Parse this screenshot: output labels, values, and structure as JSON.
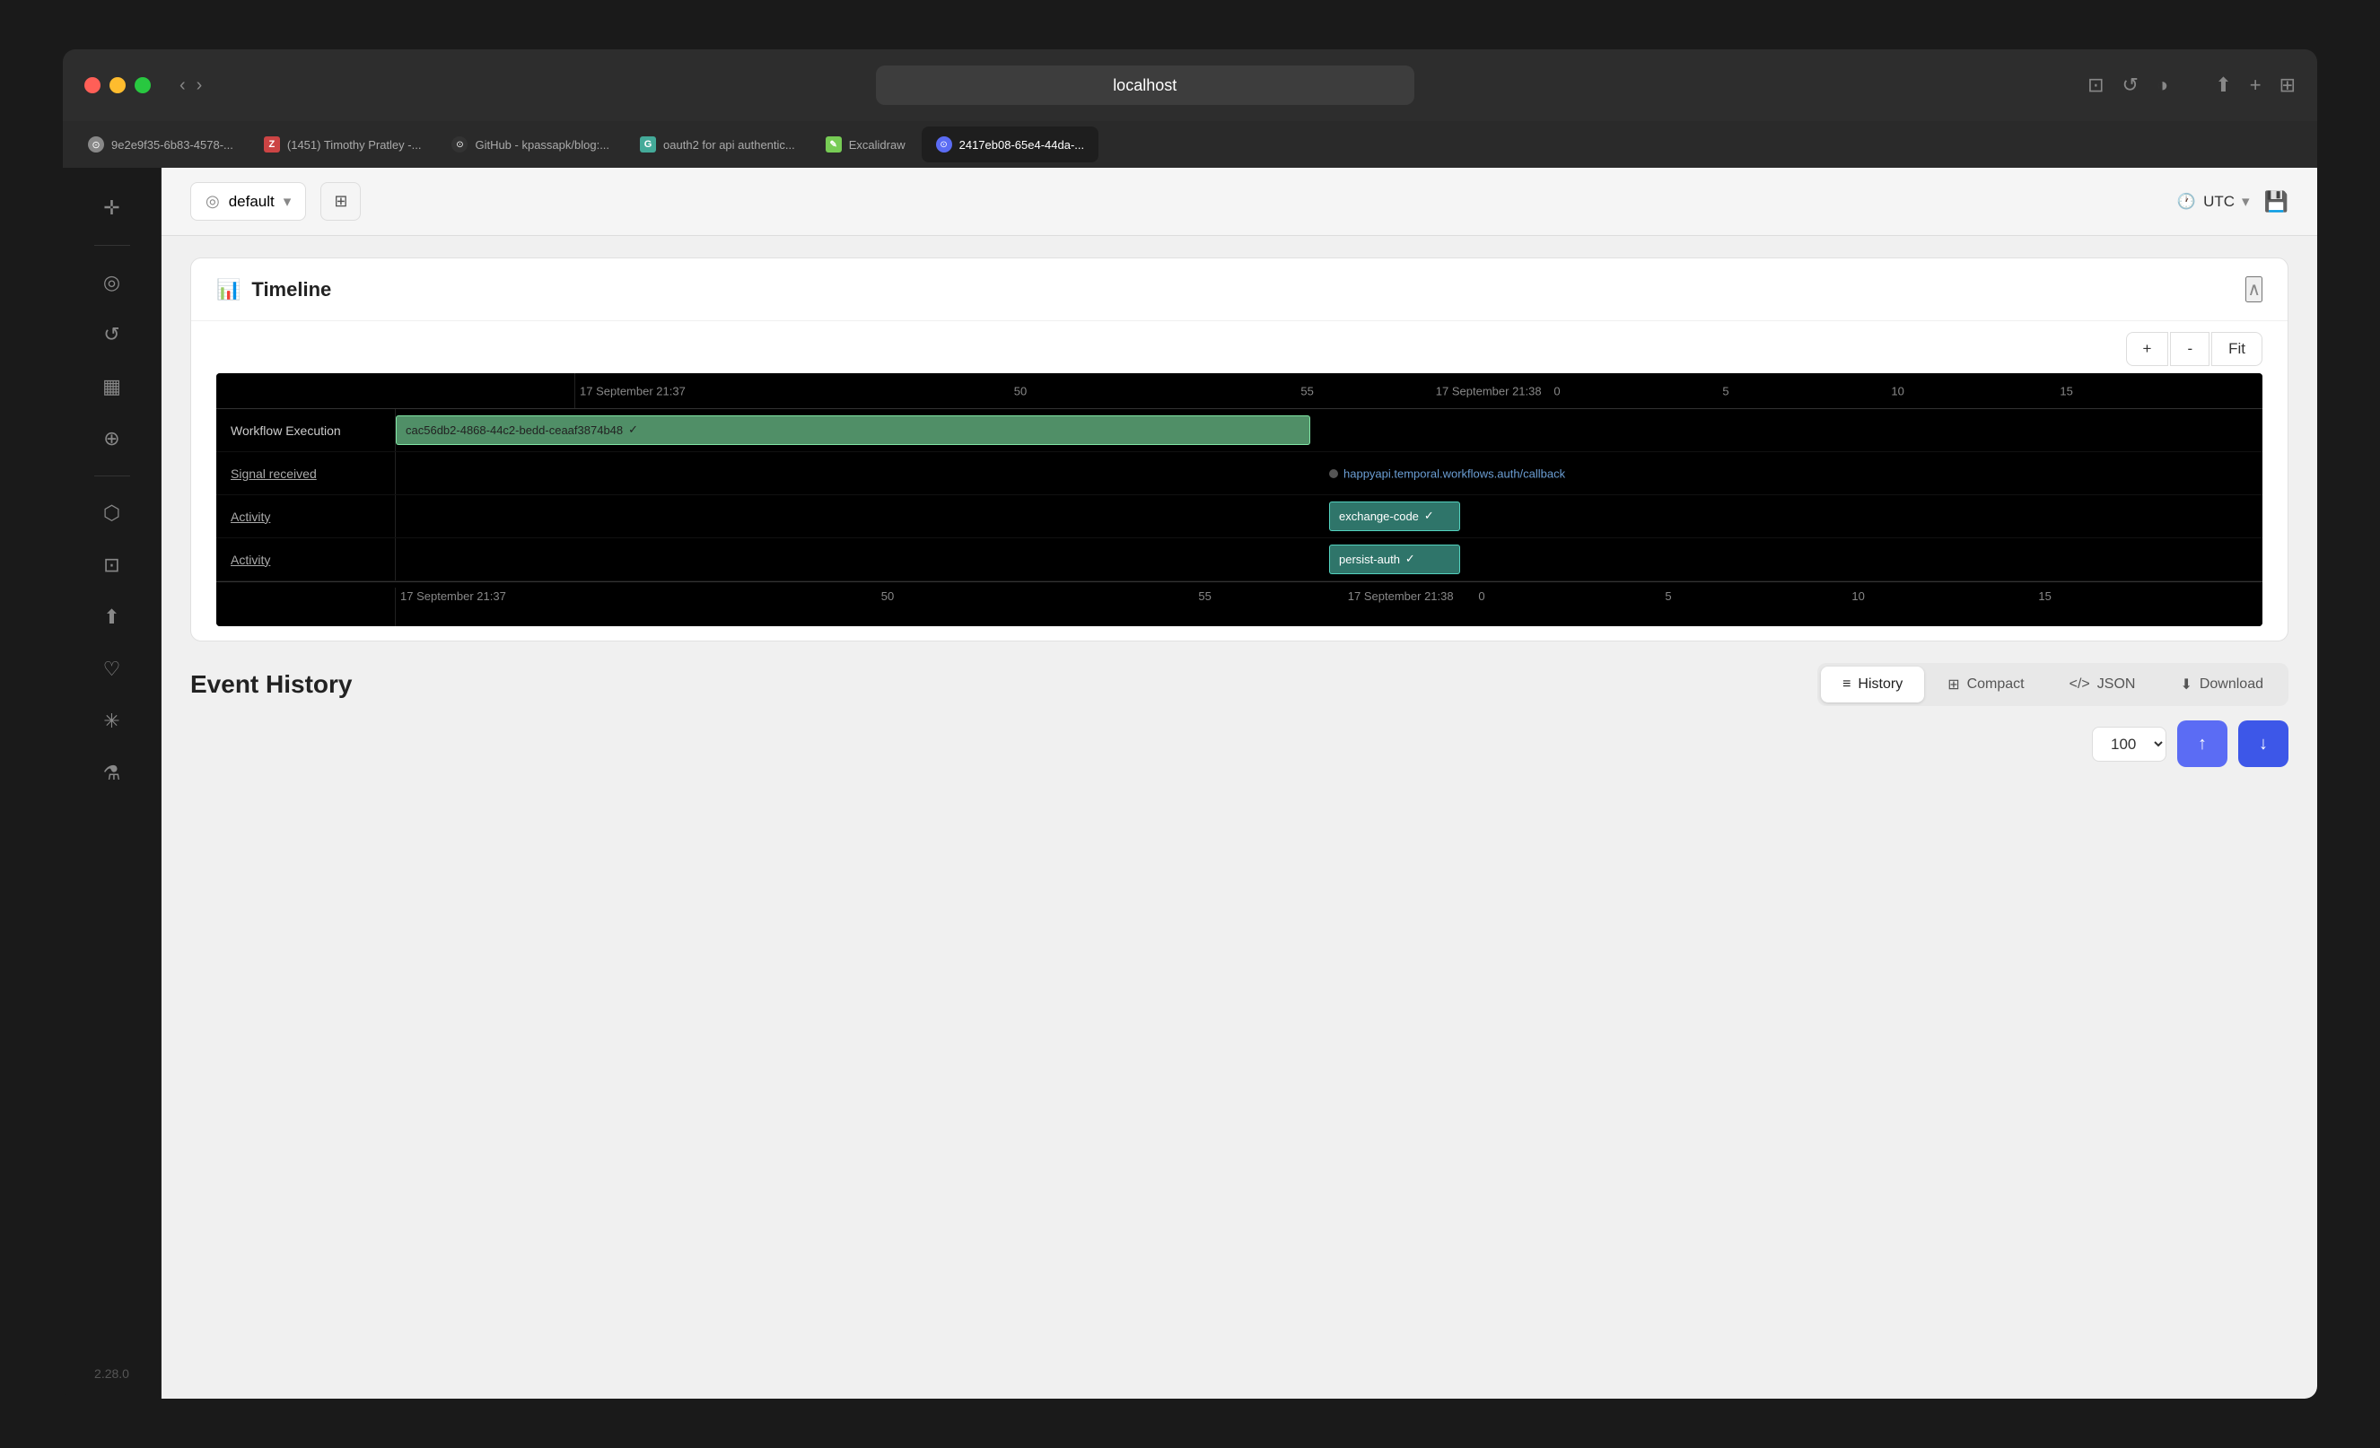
{
  "window": {
    "title": "localhost"
  },
  "tabs": [
    {
      "id": "tab1",
      "label": "9e2e9f35-6b83-4578-...",
      "icon_color": "#888",
      "icon_type": "globe",
      "active": false
    },
    {
      "id": "tab2",
      "label": "(1451) Timothy Pratley -...",
      "icon_color": "#e55",
      "icon_type": "z",
      "active": false
    },
    {
      "id": "tab3",
      "label": "GitHub - kpassapk/blog:...",
      "icon_color": "#333",
      "icon_type": "gh",
      "active": false
    },
    {
      "id": "tab4",
      "label": "oauth2 for api authentic...",
      "icon_color": "#4a9",
      "icon_type": "g",
      "active": false
    },
    {
      "id": "tab5",
      "label": "Excalidraw",
      "icon_color": "#7c5",
      "icon_type": "ex",
      "active": false
    },
    {
      "id": "tab6",
      "label": "2417eb08-65e4-44da-...",
      "icon_color": "#888",
      "icon_type": "globe",
      "active": true
    }
  ],
  "sidebar": {
    "icons": [
      {
        "name": "crosshair-icon",
        "symbol": "✛"
      },
      {
        "name": "eye-icon",
        "symbol": "◎"
      },
      {
        "name": "history-icon",
        "symbol": "↺"
      },
      {
        "name": "table-icon",
        "symbol": "▦"
      },
      {
        "name": "layers-icon",
        "symbol": "⊕"
      }
    ],
    "bottom_icons": [
      {
        "name": "box-icon",
        "symbol": "⬡"
      },
      {
        "name": "inbox-icon",
        "symbol": "⊡"
      },
      {
        "name": "upload-icon",
        "symbol": "⬆"
      },
      {
        "name": "heart-icon",
        "symbol": "♡"
      },
      {
        "name": "sparkle-icon",
        "symbol": "✳"
      },
      {
        "name": "flask-icon",
        "symbol": "⚗"
      }
    ],
    "version": "2.28.0"
  },
  "topbar": {
    "namespace": {
      "value": "default",
      "placeholder": "default"
    },
    "timezone": "UTC",
    "save_icon": "💾"
  },
  "timeline": {
    "title": "Timeline",
    "zoom_plus": "+",
    "zoom_minus": "-",
    "zoom_fit": "Fit",
    "ruler_left": {
      "date": "17 September 21:37",
      "ticks": [
        "50",
        "55"
      ]
    },
    "ruler_right": {
      "date": "17 September 21:38",
      "ticks": [
        "0",
        "5",
        "10",
        "15"
      ]
    },
    "rows": [
      {
        "label": "Workflow Execution",
        "type": "bar",
        "bar_text": "cac56db2-4868-44c2-bedd-ceaaf3874b48",
        "has_check": true,
        "bar_style": "green",
        "bar_left_pct": 0,
        "bar_width_pct": 49
      },
      {
        "label": "Signal received",
        "type": "signal",
        "signal_text": "happyapi.temporal.workflows.auth/callback",
        "signal_pos_pct": 50
      },
      {
        "label": "Activity",
        "type": "bar",
        "bar_text": "exchange-code",
        "has_check": true,
        "bar_style": "teal",
        "bar_left_pct": 50,
        "bar_width_pct": 6
      },
      {
        "label": "Activity",
        "type": "bar",
        "bar_text": "persist-auth",
        "has_check": true,
        "bar_style": "teal",
        "bar_left_pct": 50,
        "bar_width_pct": 6
      }
    ],
    "bottom_ruler": {
      "left_date": "17 September 21:37",
      "right_date": "17 September 21:38",
      "ticks_left": [
        "50",
        "55"
      ],
      "ticks_right": [
        "0",
        "5",
        "10",
        "15"
      ]
    }
  },
  "event_history": {
    "title": "Event History",
    "tabs": [
      {
        "id": "history",
        "label": "History",
        "icon": "≡",
        "active": true
      },
      {
        "id": "compact",
        "label": "Compact",
        "icon": "⊞",
        "active": false
      },
      {
        "id": "json",
        "label": "JSON",
        "icon": "</>",
        "active": false
      },
      {
        "id": "download",
        "label": "Download",
        "icon": "⬇",
        "active": false
      }
    ],
    "pagination": {
      "page_size": "100",
      "up_btn": "↑",
      "down_btn": "↓"
    }
  }
}
